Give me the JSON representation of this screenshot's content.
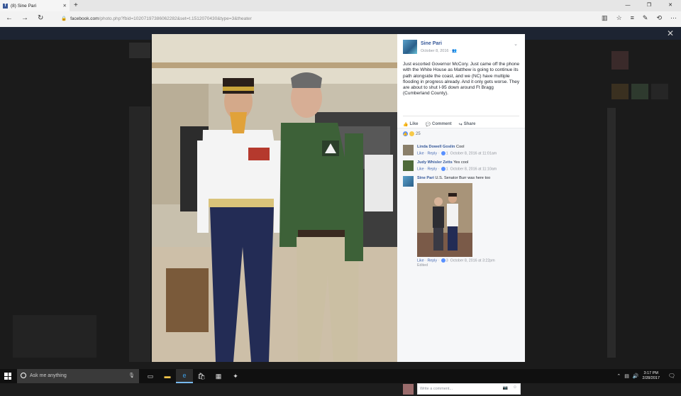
{
  "browser": {
    "tab_title": "(8) Sine Pari",
    "tab_favicon": "f",
    "url_host": "facebook.com",
    "url_path": "/photo.php?fbid=10207197386062282&set=t.1512070430&type=3&theater"
  },
  "post": {
    "author": "Sine Pari",
    "date": "October 8, 2016",
    "text": "Just escorted Governor McCory. Just came off the phone with the White House as Matthew is going to continue its path alongside the coast, and we (NC) have multiple flooding in progress already. And it only gets worse. They are about to shut I-95 down around Ft Bragg (Cumberland County).",
    "actions": {
      "like": "Like",
      "comment": "Comment",
      "share": "Share"
    },
    "reaction_count": "25"
  },
  "comments": [
    {
      "author": "Linda Dowell Goslin",
      "text": "Cool",
      "like": "Like",
      "reply": "Reply",
      "likes": "1",
      "time": "October 8, 2016 at 11:01am"
    },
    {
      "author": "Judy Whisler Zetts",
      "text": "Yes cool",
      "like": "Like",
      "reply": "Reply",
      "likes": "1",
      "time": "October 8, 2016 at 11:10am"
    },
    {
      "author": "Sine Pari",
      "text": "U.S. Senator Burr was here too",
      "like": "Like",
      "reply": "Reply",
      "likes": "3",
      "time": "October 8, 2016 at 3:22pm",
      "edited": "Edited"
    }
  ],
  "write_comment_placeholder": "Write a comment...",
  "taskbar": {
    "search_placeholder": "Ask me anything",
    "time": "3:17 PM",
    "date": "2/28/2017"
  },
  "icons": [
    "close-icon",
    "back-icon",
    "forward-icon",
    "refresh-icon",
    "lock-icon",
    "reading-view-icon",
    "favorite-icon",
    "hub-icon",
    "notes-icon",
    "share-icon",
    "more-icon",
    "windows-start-icon",
    "search-icon",
    "mic-icon",
    "task-view-icon",
    "file-explorer-icon",
    "edge-icon",
    "store-icon",
    "calculator-icon",
    "app-icon",
    "notification-icon"
  ]
}
